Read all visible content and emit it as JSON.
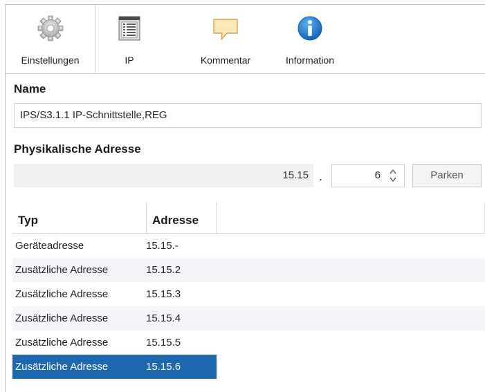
{
  "tabs": [
    {
      "label": "Einstellungen",
      "icon": "gear-icon",
      "active": true
    },
    {
      "label": "IP",
      "icon": "ip-list-icon",
      "active": false
    },
    {
      "label": "Kommentar",
      "icon": "comment-icon",
      "active": false
    },
    {
      "label": "Information",
      "icon": "info-icon",
      "active": false
    }
  ],
  "name": {
    "title": "Name",
    "value": "IPS/S3.1.1 IP-Schnittstelle,REG"
  },
  "physical_address": {
    "title": "Physikalische Adresse",
    "prefix": "15.15",
    "separator": ".",
    "device_number": "6",
    "park_button": "Parken"
  },
  "table": {
    "columns": [
      "Typ",
      "Adresse"
    ],
    "rows": [
      {
        "type": "Geräteadresse",
        "address": "15.15.-"
      },
      {
        "type": "Zusätzliche Adresse",
        "address": "15.15.2"
      },
      {
        "type": "Zusätzliche Adresse",
        "address": "15.15.3"
      },
      {
        "type": "Zusätzliche Adresse",
        "address": "15.15.4"
      },
      {
        "type": "Zusätzliche Adresse",
        "address": "15.15.5"
      },
      {
        "type": "Zusätzliche Adresse",
        "address": "15.15.6"
      }
    ],
    "selected_row": 5
  },
  "colors": {
    "selection": "#1e68b0",
    "info_blue": "#1f7fd1",
    "comment_fill": "#fde7b8",
    "comment_stroke": "#e0a24a"
  }
}
